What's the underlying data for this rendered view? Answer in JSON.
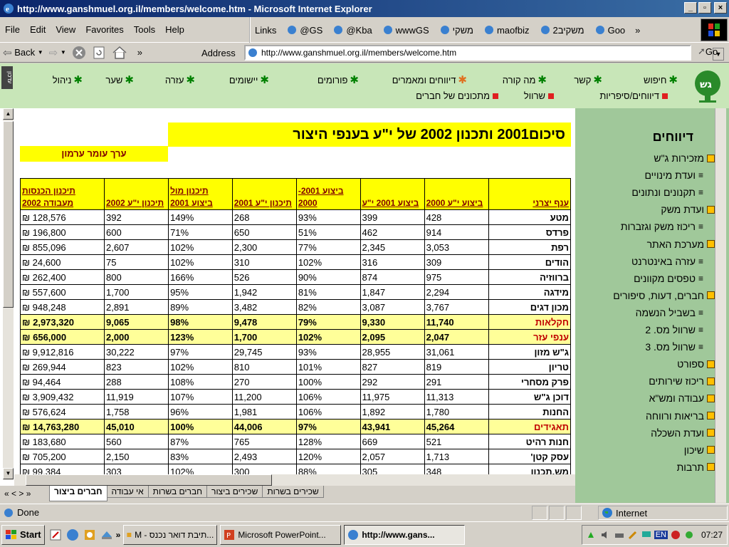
{
  "window": {
    "title": "http://www.ganshmuel.org.il/members/welcome.htm - Microsoft Internet Explorer"
  },
  "menu": [
    "File",
    "Edit",
    "View",
    "Favorites",
    "Tools",
    "Help"
  ],
  "links": {
    "label": "Links",
    "items": [
      "@GS",
      "@Kba",
      "wwwGS",
      "משקי",
      "maofbiz",
      "משקיב2",
      "Goo"
    ],
    "more": "»"
  },
  "toolbar": {
    "back": "Back",
    "more": "»",
    "address_label": "Address",
    "url": "http://www.ganshmuel.org.il/members/welcome.htm",
    "go": "Go"
  },
  "topnav": {
    "row1": [
      "חיפוש",
      "קשר",
      "מה קורה",
      "דיווחים ומאמרים",
      "פורומים",
      "יישומים",
      "עזרה",
      "שער",
      "ניהול"
    ],
    "row2": [
      "דיווחים/סיפריות",
      "שרוול",
      "מתכונים של חברים"
    ],
    "side_label": "עדכון"
  },
  "page": {
    "title": "סיכום2001 ותכנון  2002 של י\"ע בענפי היצור",
    "subtitle": "ערך עומר ערמון"
  },
  "table": {
    "headers": [
      "ענף יצרני",
      "ביצוע י\"ע 2000",
      "ביצוע 2001 י\"ע",
      "ביצוע 2001- 2000",
      "תיכנון י\"ע 2001",
      "תיכנון מול ביצוע 2001",
      "תיכנון י\"ע 2002",
      "תיכנון הכנסות מעבודה 2002"
    ],
    "rows": [
      {
        "cat": "מטע",
        "v": [
          "428",
          "399",
          "93%",
          "268",
          "149%",
          "392",
          "128,576 ₪"
        ],
        "hl": false
      },
      {
        "cat": "פרדס",
        "v": [
          "914",
          "462",
          "51%",
          "650",
          "71%",
          "600",
          "196,800 ₪"
        ],
        "hl": false
      },
      {
        "cat": "רפת",
        "v": [
          "3,053",
          "2,345",
          "77%",
          "2,300",
          "102%",
          "2,607",
          "855,096 ₪"
        ],
        "hl": false
      },
      {
        "cat": "הודים",
        "v": [
          "309",
          "316",
          "102%",
          "310",
          "102%",
          "75",
          "24,600 ₪"
        ],
        "hl": false
      },
      {
        "cat": "ברווזיה",
        "v": [
          "975",
          "874",
          "90%",
          "526",
          "166%",
          "800",
          "262,400 ₪"
        ],
        "hl": false
      },
      {
        "cat": "מידגה",
        "v": [
          "2,294",
          "1,847",
          "81%",
          "1,942",
          "95%",
          "1,700",
          "557,600 ₪"
        ],
        "hl": false
      },
      {
        "cat": "מכון דגים",
        "v": [
          "3,767",
          "3,087",
          "82%",
          "3,482",
          "89%",
          "2,891",
          "948,248 ₪"
        ],
        "hl": false
      },
      {
        "cat": "חקלאות",
        "v": [
          "11,740",
          "9,330",
          "79%",
          "9,478",
          "98%",
          "9,065",
          "2,973,320 ₪"
        ],
        "hl": true
      },
      {
        "cat": "ענפי עזר",
        "v": [
          "2,047",
          "2,095",
          "102%",
          "1,700",
          "123%",
          "2,000",
          "656,000 ₪"
        ],
        "hl": true
      },
      {
        "cat": "ג\"ש מזון",
        "v": [
          "31,061",
          "28,955",
          "93%",
          "29,745",
          "97%",
          "30,222",
          "9,912,816 ₪"
        ],
        "hl": false
      },
      {
        "cat": "טריון",
        "v": [
          "819",
          "827",
          "101%",
          "810",
          "102%",
          "823",
          "269,944 ₪"
        ],
        "hl": false
      },
      {
        "cat": "פרק מסחרי",
        "v": [
          "291",
          "292",
          "100%",
          "270",
          "108%",
          "288",
          "94,464 ₪"
        ],
        "hl": false
      },
      {
        "cat": "דוכן ג\"ש",
        "v": [
          "11,313",
          "11,975",
          "106%",
          "11,200",
          "107%",
          "11,919",
          "3,909,432 ₪"
        ],
        "hl": false
      },
      {
        "cat": "החנות",
        "v": [
          "1,780",
          "1,892",
          "106%",
          "1,981",
          "96%",
          "1,758",
          "576,624 ₪"
        ],
        "hl": false
      },
      {
        "cat": "תאגידים",
        "v": [
          "45,264",
          "43,941",
          "97%",
          "44,006",
          "100%",
          "45,010",
          "14,763,280 ₪"
        ],
        "hl": true
      },
      {
        "cat": "חנות רהיט",
        "v": [
          "521",
          "669",
          "128%",
          "765",
          "87%",
          "560",
          "183,680 ₪"
        ],
        "hl": false
      },
      {
        "cat": "עסק קטן'",
        "v": [
          "1,713",
          "2,057",
          "120%",
          "2,493",
          "83%",
          "2,150",
          "705,200 ₪"
        ],
        "hl": false
      },
      {
        "cat": "מש.תכנון",
        "v": [
          "348",
          "305",
          "88%",
          "300",
          "102%",
          "303",
          "99,384 ₪"
        ],
        "hl": false
      }
    ]
  },
  "sidebar": {
    "title": "דיווחים",
    "items": [
      {
        "label": "מזכירות ג\"ש",
        "type": "main"
      },
      {
        "label": "ועדת מינויים",
        "type": "sub"
      },
      {
        "label": "תקנונים ונתונים",
        "type": "sub"
      },
      {
        "label": "ועדת משק",
        "type": "main"
      },
      {
        "label": "ריכוז משק וגזברות",
        "type": "sub"
      },
      {
        "label": "מערכת האתר",
        "type": "main"
      },
      {
        "label": "עזרה באינטרנט",
        "type": "sub"
      },
      {
        "label": "טפסים מקוונים",
        "type": "sub"
      },
      {
        "label": "חברים, דעות, סיפורים",
        "type": "main"
      },
      {
        "label": "בשביל הנשמה",
        "type": "sub"
      },
      {
        "label": "שרוול מס. 2",
        "type": "sub"
      },
      {
        "label": "שרוול מס. 3",
        "type": "sub"
      },
      {
        "label": "ספורט",
        "type": "main"
      },
      {
        "label": "ריכוז שירותים",
        "type": "main"
      },
      {
        "label": "עבודה ומש\"א",
        "type": "main"
      },
      {
        "label": "בריאות ורווחה",
        "type": "main"
      },
      {
        "label": "ועדת השכלה",
        "type": "main"
      },
      {
        "label": "שיכון",
        "type": "main"
      },
      {
        "label": "תרבות",
        "type": "main"
      }
    ]
  },
  "sheet_tabs": {
    "nav": "« < > »",
    "items": [
      "חברים ביצור",
      "אי עבודה",
      "חברים בשרות",
      "שכירים ביצור",
      "שכירים בשרות"
    ],
    "active": 0
  },
  "status": {
    "text": "Done",
    "zone": "Internet"
  },
  "taskbar": {
    "start": "Start",
    "more": "»",
    "tasks": [
      "M - תיבת דואר נכנס...",
      "Microsoft PowerPoint...",
      "http://www.gans..."
    ],
    "active": 2,
    "clock": "07:27",
    "lang": "EN"
  }
}
